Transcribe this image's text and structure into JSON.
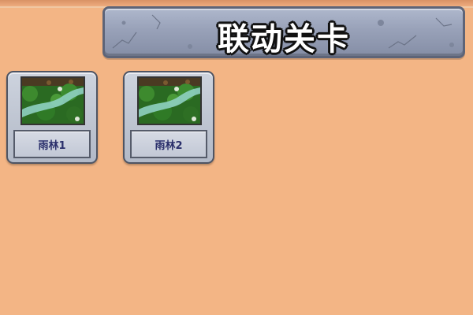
{
  "header": {
    "title": "联动关卡"
  },
  "levels": [
    {
      "label": "雨林1",
      "scene": "rainforest"
    },
    {
      "label": "雨林2",
      "scene": "rainforest"
    }
  ],
  "colors": {
    "background": "#f3b585",
    "stone": "#98a1b8",
    "label_text": "#2a2f6b"
  }
}
